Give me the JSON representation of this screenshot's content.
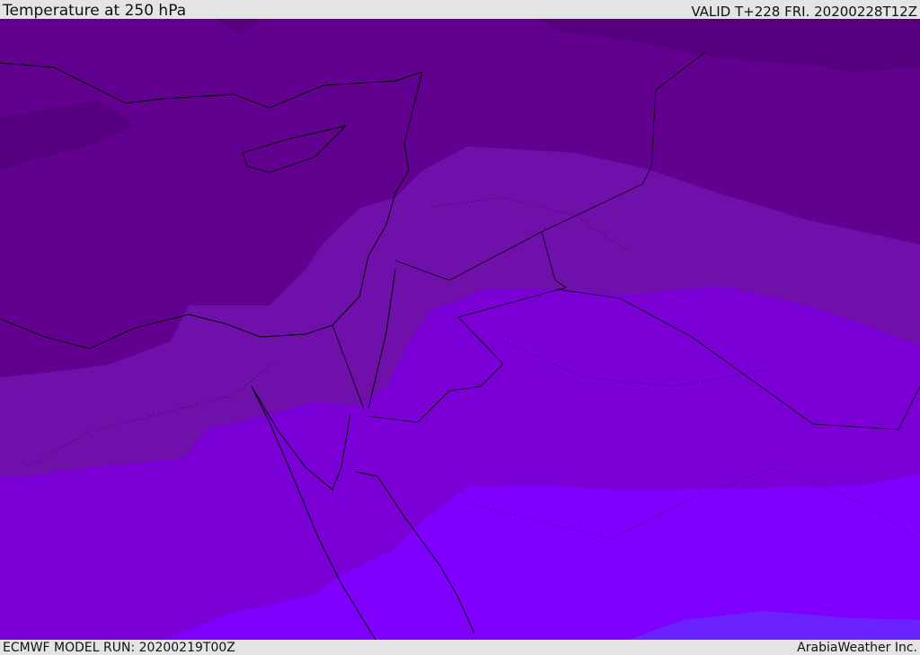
{
  "header": {
    "title": "Temperature at 250 hPa",
    "valid": "VALID T+228 FRI. 20200228T12Z"
  },
  "footer": {
    "model_run": "ECMWF MODEL RUN: 20200219T00Z",
    "credit": "ArabiaWeather Inc."
  },
  "colors": {
    "band1": "#56007f",
    "band2": "#62008f",
    "band3": "#7010ab",
    "band4": "#7a00d6",
    "band5": "#7f00ff",
    "band6": "#6a22ff",
    "bar": "#e4e4e4"
  }
}
